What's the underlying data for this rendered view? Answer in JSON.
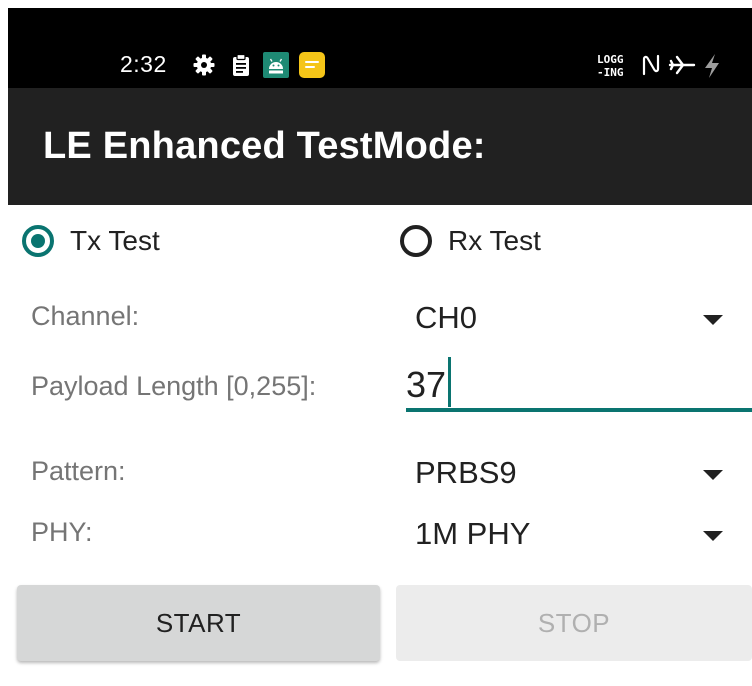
{
  "status_bar": {
    "time": "2:32",
    "left_icons": [
      "gear-icon",
      "clipboard-icon",
      "android-app-icon",
      "message-icon"
    ],
    "logging_text": "LOGG\n-ING",
    "right_icons": [
      "nfc-icon",
      "airplane-icon",
      "charging-icon"
    ]
  },
  "app_bar": {
    "title": "LE Enhanced TestMode:"
  },
  "radio_group": {
    "tx": {
      "label": "Tx Test",
      "checked": true
    },
    "rx": {
      "label": "Rx Test",
      "checked": false
    }
  },
  "form": {
    "channel": {
      "label": "Channel:",
      "value": "CH0"
    },
    "payload_length": {
      "label": "Payload Length [0,255]:",
      "value": "37"
    },
    "pattern": {
      "label": "Pattern:",
      "value": "PRBS9"
    },
    "phy": {
      "label": "PHY:",
      "value": "1M PHY"
    }
  },
  "buttons": {
    "start": "START",
    "stop": "STOP"
  },
  "colors": {
    "accent": "#0a7470",
    "app_bar": "#212121",
    "status_bar": "#000000",
    "start_button": "#d6d7d7",
    "stop_button": "#ececec"
  }
}
